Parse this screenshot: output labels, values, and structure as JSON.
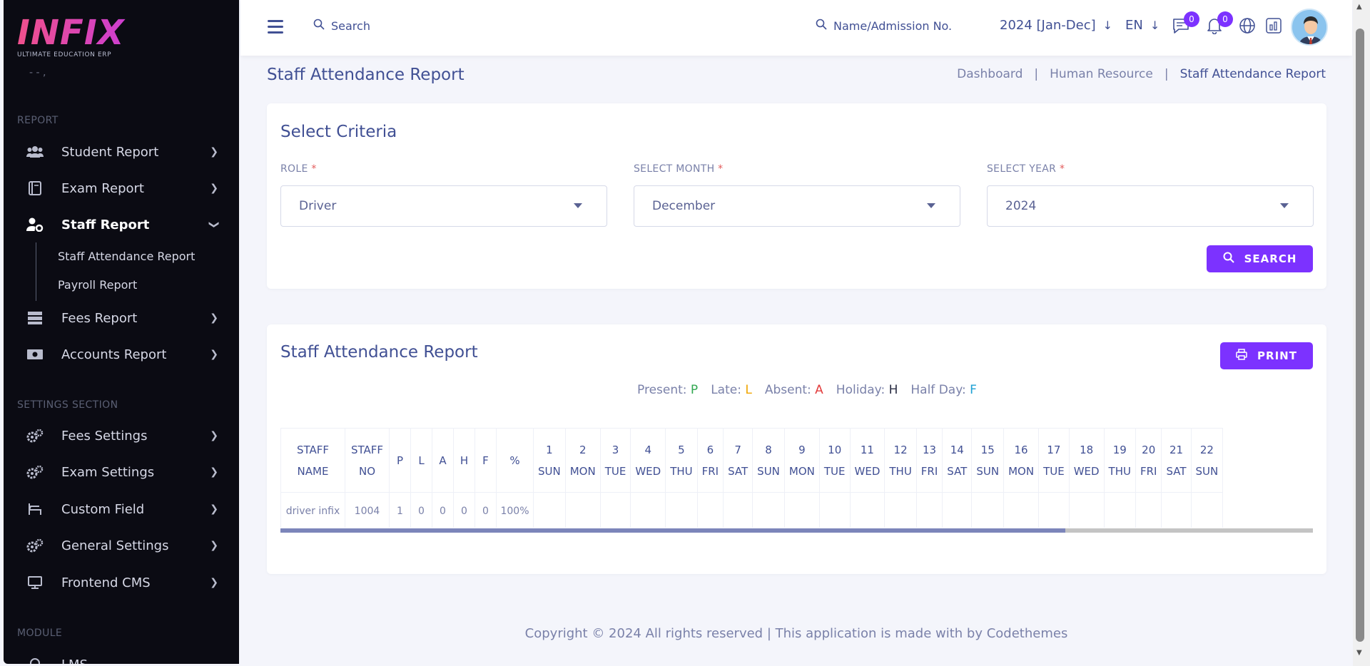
{
  "brand": {
    "logo": "INFIX",
    "tagline": "ULTIMATE EDUCATION ERP"
  },
  "sidebar": {
    "cut_item": "- - ,",
    "section_report": "REPORT",
    "items_report": [
      {
        "label": "Student Report",
        "icon": "users-icon"
      },
      {
        "label": "Exam Report",
        "icon": "book-icon"
      },
      {
        "label": "Staff Report",
        "icon": "user-gear-icon"
      },
      {
        "label": "Fees Report",
        "icon": "database-icon"
      },
      {
        "label": "Accounts Report",
        "icon": "money-icon"
      }
    ],
    "sub_items": [
      "Staff Attendance Report",
      "Payroll Report"
    ],
    "section_settings": "SETTINGS SECTION",
    "items_settings": [
      {
        "label": "Fees Settings",
        "icon": "gears-icon"
      },
      {
        "label": "Exam Settings",
        "icon": "gears-icon"
      },
      {
        "label": "Custom Field",
        "icon": "chair-icon"
      },
      {
        "label": "General Settings",
        "icon": "gears-icon"
      },
      {
        "label": "Frontend CMS",
        "icon": "monitor-icon"
      }
    ],
    "section_module": "MODULE",
    "cut_module_item": "LMS"
  },
  "topbar": {
    "search_label": "Search",
    "name_search_label": "Name/Admission No.",
    "year": "2024 [Jan-Dec]",
    "lang": "EN",
    "messages_count": "0",
    "notifications_count": "0"
  },
  "page": {
    "title": "Staff Attendance Report",
    "breadcrumb": [
      "Dashboard",
      "Human Resource",
      "Staff Attendance Report"
    ],
    "separator": "|"
  },
  "criteria": {
    "title": "Select Criteria",
    "role_label": "ROLE",
    "month_label": "SELECT MONTH",
    "year_label": "SELECT YEAR",
    "required_mark": "*",
    "role_value": "Driver",
    "month_value": "December",
    "year_value": "2024",
    "search_button": "SEARCH"
  },
  "report": {
    "title": "Staff Attendance Report",
    "print_button": "PRINT",
    "legend": {
      "present_label": "Present:",
      "present_code": "P",
      "late_label": "Late:",
      "late_code": "L",
      "absent_label": "Absent:",
      "absent_code": "A",
      "holiday_label": "Holiday:",
      "holiday_code": "H",
      "halfday_label": "Half Day:",
      "halfday_code": "F"
    },
    "columns": [
      [
        "STAFF",
        "NAME"
      ],
      [
        "STAFF",
        "NO"
      ],
      [
        "P"
      ],
      [
        "L"
      ],
      [
        "A"
      ],
      [
        "H"
      ],
      [
        "F"
      ],
      [
        "%"
      ],
      [
        "1",
        "SUN"
      ],
      [
        "2",
        "MON"
      ],
      [
        "3",
        "TUE"
      ],
      [
        "4",
        "WED"
      ],
      [
        "5",
        "THU"
      ],
      [
        "6",
        "FRI"
      ],
      [
        "7",
        "SAT"
      ],
      [
        "8",
        "SUN"
      ],
      [
        "9",
        "MON"
      ],
      [
        "10",
        "TUE"
      ],
      [
        "11",
        "WED"
      ],
      [
        "12",
        "THU"
      ],
      [
        "13",
        "FRI"
      ],
      [
        "14",
        "SAT"
      ],
      [
        "15",
        "SUN"
      ],
      [
        "16",
        "MON"
      ],
      [
        "17",
        "TUE"
      ],
      [
        "18",
        "WED"
      ],
      [
        "19",
        "THU"
      ],
      [
        "20",
        "FRI"
      ],
      [
        "21",
        "SAT"
      ],
      [
        "22",
        "SUN"
      ]
    ],
    "rows": [
      [
        "driver infix",
        "1004",
        "1",
        "0",
        "0",
        "0",
        "0",
        "100%",
        "",
        "",
        "",
        "",
        "",
        "",
        "",
        "",
        "",
        "",
        "",
        "",
        "",
        "",
        "",
        "",
        "",
        "",
        "",
        "",
        "",
        ""
      ]
    ],
    "scroll_progress": 0.76
  },
  "footer": {
    "text": "Copyright © 2024 All rights reserved | This application is made with by Codethemes"
  },
  "colors": {
    "accent": "#7c32ff",
    "primary_text": "#415094",
    "sidebar_bg": "#0b0b13"
  }
}
